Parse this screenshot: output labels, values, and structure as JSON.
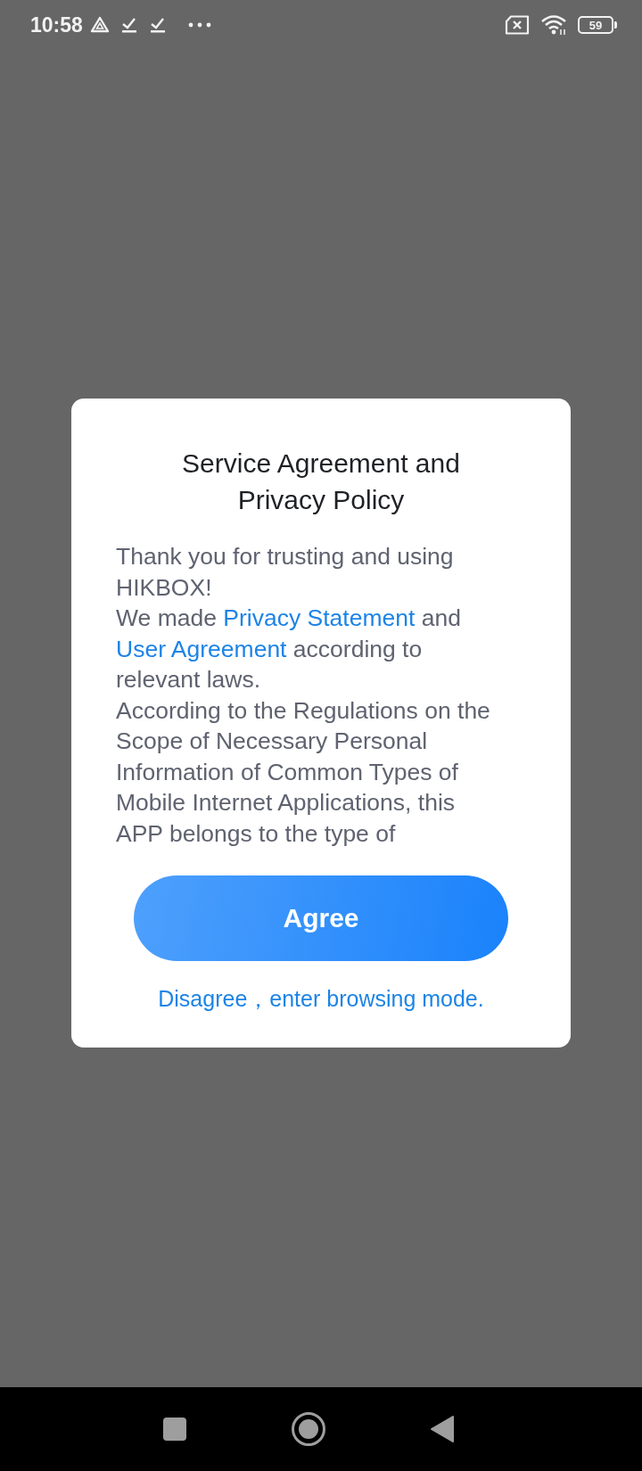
{
  "status_bar": {
    "time": "10:58",
    "battery": "59"
  },
  "dialog": {
    "title": "Service Agreement and Privacy Policy",
    "paragraphs": [
      [
        {
          "text": "Thank you for trusting and using HIKBOX!",
          "kind": "plain"
        }
      ],
      [
        {
          "text": "We made ",
          "kind": "plain"
        },
        {
          "text": "Privacy Statement",
          "kind": "link"
        },
        {
          "text": " and ",
          "kind": "plain"
        },
        {
          "text": "User Agreement",
          "kind": "link"
        },
        {
          "text": " according to relevant laws.",
          "kind": "plain"
        }
      ],
      [
        {
          "text": "According to the Regulations on the Scope of Necessary Personal Information of Common Types of Mobile Internet Applications, this APP belongs to the type of",
          "kind": "plain"
        }
      ]
    ],
    "agree_button": "Agree",
    "disagree_link": "Disagree，enter browsing mode."
  }
}
